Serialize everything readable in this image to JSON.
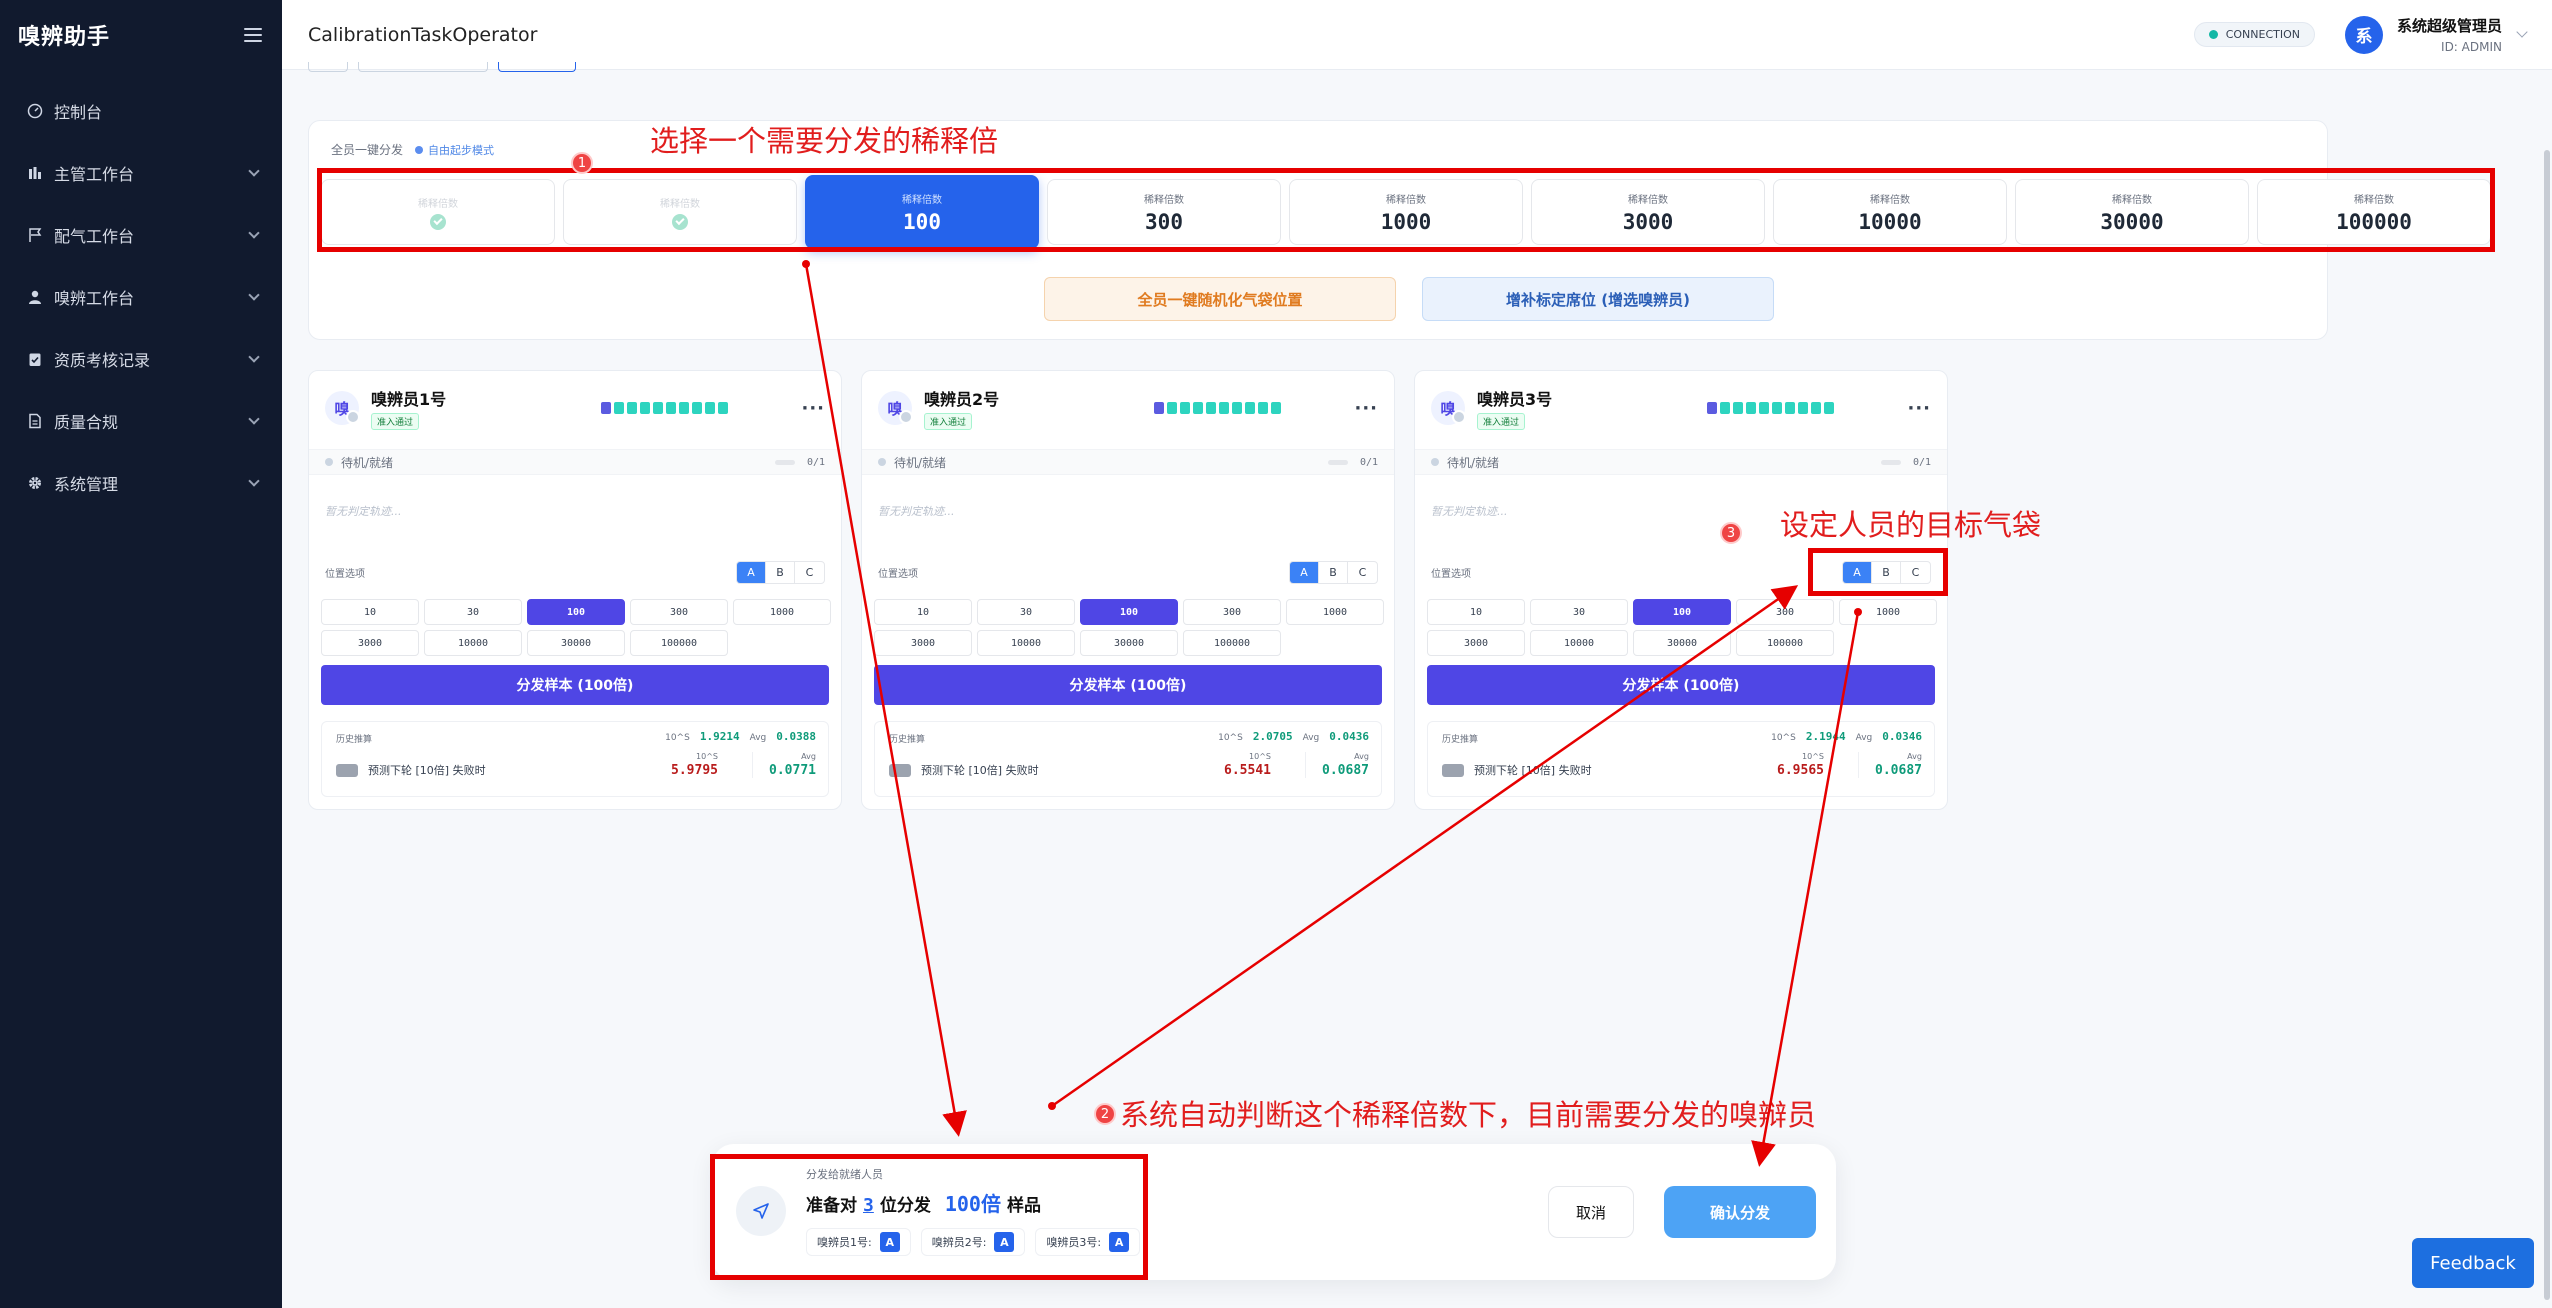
{
  "app": {
    "name": "嗅辨助手",
    "page_title": "CalibrationTaskOperator"
  },
  "sidebar": {
    "items": [
      {
        "label": "控制台",
        "icon": "gauge-icon",
        "expandable": false
      },
      {
        "label": "主管工作台",
        "icon": "bar-chart-icon",
        "expandable": true
      },
      {
        "label": "配气工作台",
        "icon": "flag-icon",
        "expandable": true
      },
      {
        "label": "嗅辨工作台",
        "icon": "user-icon",
        "expandable": true
      },
      {
        "label": "资质考核记录",
        "icon": "clipboard-check-icon",
        "expandable": true
      },
      {
        "label": "质量合规",
        "icon": "document-icon",
        "expandable": true
      },
      {
        "label": "系统管理",
        "icon": "gear-icon",
        "expandable": true
      }
    ]
  },
  "header": {
    "connection": "CONNECTION",
    "avatar_text": "系",
    "user_name": "系统超级管理员",
    "user_id": "ID: ADMIN"
  },
  "dispatch_panel": {
    "label": "全员一键分发",
    "mode": "自由起步模式",
    "dilution_label": "稀释倍数",
    "dilutions": [
      {
        "value": "",
        "state": "done"
      },
      {
        "value": "",
        "state": "done"
      },
      {
        "value": "100",
        "state": "active"
      },
      {
        "value": "300",
        "state": "idle"
      },
      {
        "value": "1000",
        "state": "idle"
      },
      {
        "value": "3000",
        "state": "idle"
      },
      {
        "value": "10000",
        "state": "idle"
      },
      {
        "value": "30000",
        "state": "idle"
      },
      {
        "value": "100000",
        "state": "idle"
      }
    ],
    "random_button": "全员一键随机化气袋位置",
    "add_seat_button": "增补标定席位 (增选嗅辨员)"
  },
  "operators": [
    {
      "name": "嗅辨员1号",
      "avatar": "嗅",
      "badge": "准入通过",
      "status": "待机/就绪",
      "count": "0/1",
      "empty": "暂无判定轨迹...",
      "position_label": "位置选项",
      "positions": [
        "A",
        "B",
        "C"
      ],
      "selected_position": "A",
      "dilutions": [
        "10",
        "30",
        "100",
        "300",
        "1000",
        "3000",
        "10000",
        "30000",
        "100000"
      ],
      "selected_dilution": "100",
      "send_label": "分发样本 (100倍)",
      "history_label": "历史推算",
      "log_label": "10^S",
      "log_value": "1.9214",
      "avg_label": "Avg",
      "avg_value": "0.0388",
      "prediction": "预测下轮 [10倍] 失败时",
      "pred_val_label": "10^S",
      "pred_value": "5.9795",
      "pred_avg_label": "Avg",
      "pred_avg": "0.0771"
    },
    {
      "name": "嗅辨员2号",
      "avatar": "嗅",
      "badge": "准入通过",
      "status": "待机/就绪",
      "count": "0/1",
      "empty": "暂无判定轨迹...",
      "position_label": "位置选项",
      "positions": [
        "A",
        "B",
        "C"
      ],
      "selected_position": "A",
      "dilutions": [
        "10",
        "30",
        "100",
        "300",
        "1000",
        "3000",
        "10000",
        "30000",
        "100000"
      ],
      "selected_dilution": "100",
      "send_label": "分发样本 (100倍)",
      "history_label": "历史推算",
      "log_label": "10^S",
      "log_value": "2.0705",
      "avg_label": "Avg",
      "avg_value": "0.0436",
      "prediction": "预测下轮 [10倍] 失败时",
      "pred_val_label": "10^S",
      "pred_value": "6.5541",
      "pred_avg_label": "Avg",
      "pred_avg": "0.0687"
    },
    {
      "name": "嗅辨员3号",
      "avatar": "嗅",
      "badge": "准入通过",
      "status": "待机/就绪",
      "count": "0/1",
      "empty": "暂无判定轨迹...",
      "position_label": "位置选项",
      "positions": [
        "A",
        "B",
        "C"
      ],
      "selected_position": "A",
      "dilutions": [
        "10",
        "30",
        "100",
        "300",
        "1000",
        "3000",
        "10000",
        "30000",
        "100000"
      ],
      "selected_dilution": "100",
      "send_label": "分发样本 (100倍)",
      "history_label": "历史推算",
      "log_label": "10^S",
      "log_value": "2.1944",
      "avg_label": "Avg",
      "avg_value": "0.0346",
      "prediction": "预测下轮 [10倍] 失败时",
      "pred_val_label": "10^S",
      "pred_value": "6.9565",
      "pred_avg_label": "Avg",
      "pred_avg": "0.0687"
    }
  ],
  "bottom_bar": {
    "subtitle": "分发给就绪人员",
    "prefix": "准备对",
    "count": "3",
    "middle": "位分发",
    "multiple": "100倍",
    "suffix": "样品",
    "chips": [
      {
        "label": "嗅辨员1号:",
        "value": "A"
      },
      {
        "label": "嗅辨员2号:",
        "value": "A"
      },
      {
        "label": "嗅辨员3号:",
        "value": "A"
      }
    ],
    "cancel": "取消",
    "confirm": "确认分发"
  },
  "feedback": "Feedback",
  "annotations": [
    {
      "num": "1",
      "text": "选择一个需要分发的稀释倍"
    },
    {
      "num": "2",
      "text": "系统自动判断这个稀释倍数下，目前需要分发的嗅辩员"
    },
    {
      "num": "3",
      "text": "设定人员的目标气袋"
    }
  ],
  "colors": {
    "sidebar_bg": "#111a2e",
    "primary": "#2563eb",
    "indigo": "#4f46e5",
    "annotation": "#e60000",
    "teal": "#14b8a6"
  }
}
